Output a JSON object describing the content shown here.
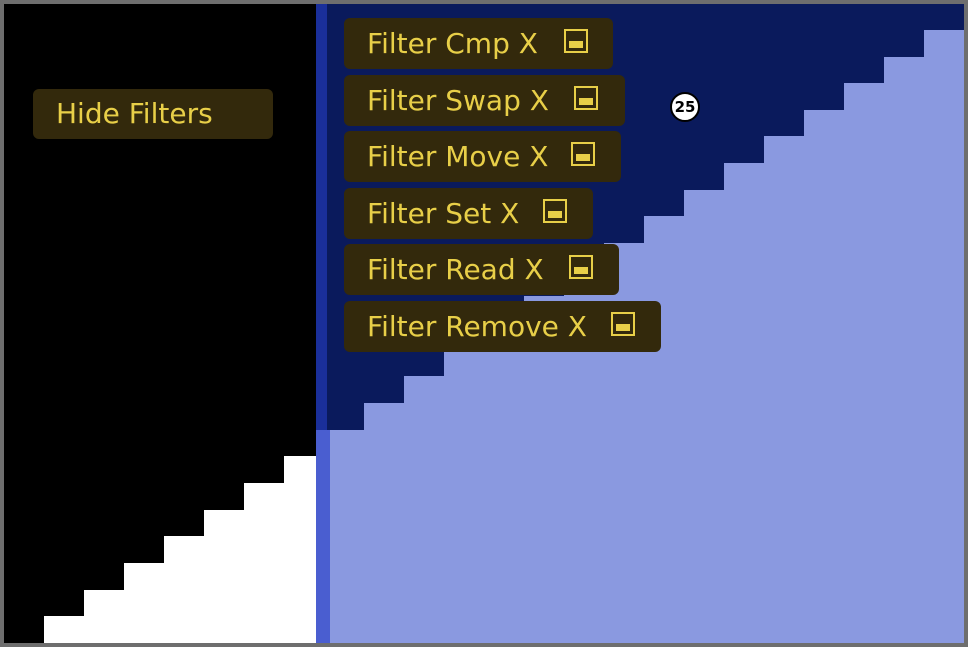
{
  "hide_filters_label": "Hide Filters",
  "filters": [
    {
      "label": "Filter Cmp X",
      "icon": "toggle-icon"
    },
    {
      "label": "Filter Swap X",
      "icon": "toggle-icon"
    },
    {
      "label": "Filter Move X",
      "icon": "toggle-icon"
    },
    {
      "label": "Filter Set X",
      "icon": "toggle-icon"
    },
    {
      "label": "Filter Read X",
      "icon": "toggle-icon"
    },
    {
      "label": "Filter Remove X",
      "icon": "toggle-icon"
    }
  ],
  "marker_value": "25",
  "colors": {
    "background": "#000000",
    "white_region": "#ffffff",
    "dark_blue_region": "#0a1a5c",
    "light_blue_region": "#8a99e0",
    "divider": "#4a5ed0",
    "button_bg": "#33290c",
    "button_text": "#e8cf48"
  }
}
